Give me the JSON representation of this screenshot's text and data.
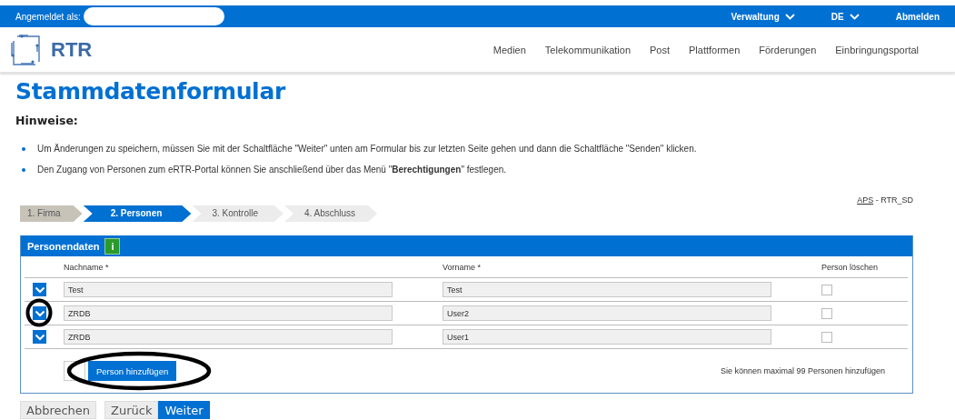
{
  "topbar": {
    "login_label": "Angemeldet als:",
    "menus": [
      {
        "label": "Verwaltung",
        "dropdown": true
      },
      {
        "label": "DE",
        "dropdown": true
      },
      {
        "label": "Abmelden",
        "dropdown": false
      }
    ]
  },
  "header": {
    "logo_text": "RTR",
    "nav": [
      "Medien",
      "Telekommunikation",
      "Post",
      "Plattformen",
      "Förderungen",
      "Einbringungsportal"
    ]
  },
  "page_title": "Stammdatenformular",
  "notes": {
    "heading": "Hinweise:",
    "items": [
      "Um Änderungen zu speichern, müssen Sie mit der Schaltfläche \"Weiter\" unten am Formular bis zur letzten Seite gehen und dann die Schaltfläche \"Senden\" klicken.",
      "Den Zugang von Personen zum eRTR-Portal können Sie anschließend über das Menü \"**Berechtigungen**\" festlegen."
    ]
  },
  "steps": [
    {
      "label": "1. Firma",
      "selected": false,
      "completed": true
    },
    {
      "label": "2. Personen",
      "selected": true,
      "completed": false
    },
    {
      "label": "3. Kontrolle",
      "selected": false,
      "completed": false
    },
    {
      "label": "4. Abschluss",
      "selected": false,
      "completed": false
    }
  ],
  "form_id": {
    "link": "APS",
    "text": "- RTR_SD"
  },
  "panel": {
    "title": "Personendaten",
    "info_icon": "i",
    "columns": [
      "Nachname *",
      "Vorname *",
      "Person löschen"
    ],
    "rows": [
      {
        "nachname": "Test",
        "vorname": "Test",
        "delete": false
      },
      {
        "nachname": "ZRDB",
        "vorname": "User2",
        "delete": false
      },
      {
        "nachname": "ZRDB",
        "vorname": "User1",
        "delete": false
      }
    ],
    "add_button": "Person hinzufügen",
    "limit_note": "Sie können maximal 99 Personen hinzufügen"
  },
  "buttons": [
    {
      "label": "Abbrechen",
      "kind": "secondary"
    },
    {
      "label": "Zurück",
      "kind": "secondary"
    },
    {
      "label": "Weiter",
      "kind": "primary"
    }
  ]
}
